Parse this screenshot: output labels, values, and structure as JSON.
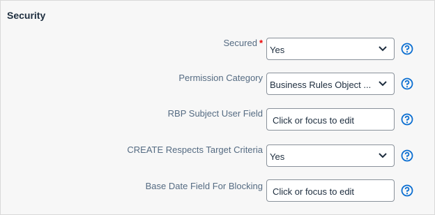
{
  "section": {
    "title": "Security"
  },
  "colors": {
    "accent": "#0a6ed1",
    "required": "#e00000",
    "label": "#556b82"
  },
  "fields": [
    {
      "label": "Secured",
      "required": true,
      "type": "select",
      "value": "Yes",
      "help_icon": "question-circle-icon"
    },
    {
      "label": "Permission Category",
      "type": "select",
      "value": "Business Rules Object ...",
      "help_icon": "question-circle-icon"
    },
    {
      "label": "RBP Subject User Field",
      "type": "input",
      "value": "Click or focus to edit",
      "help_icon": "question-circle-icon"
    },
    {
      "label": "CREATE Respects Target Criteria",
      "type": "select",
      "value": "Yes",
      "help_icon": "question-circle-icon"
    },
    {
      "label": "Base Date Field For Blocking",
      "type": "input",
      "value": "Click or focus to edit",
      "help_icon": "question-circle-icon"
    }
  ]
}
